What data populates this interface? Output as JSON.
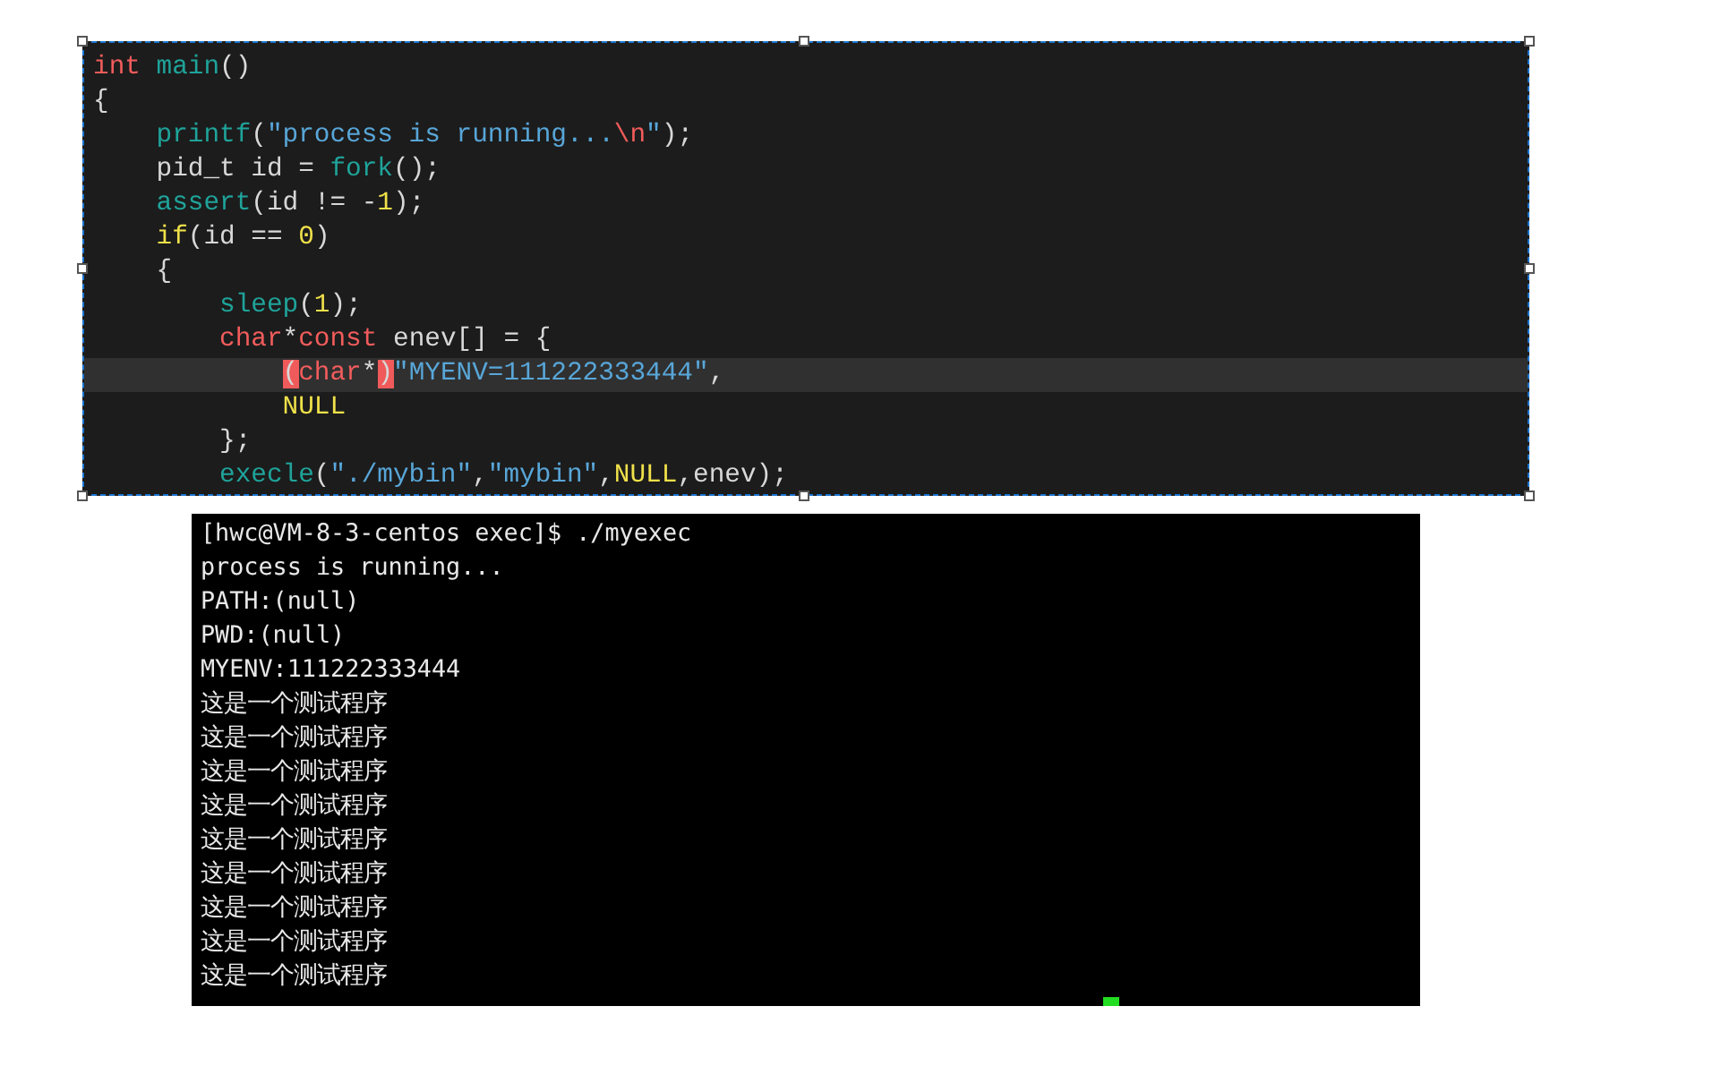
{
  "editor": {
    "lines": [
      {
        "current": false,
        "tokens": [
          {
            "text": "int ",
            "kind": "keyword"
          },
          {
            "text": "main",
            "kind": "function"
          },
          {
            "text": "()",
            "kind": "plain"
          }
        ]
      },
      {
        "current": false,
        "tokens": [
          {
            "text": "{",
            "kind": "plain"
          }
        ]
      },
      {
        "current": false,
        "tokens": [
          {
            "text": "    printf",
            "kind": "function"
          },
          {
            "text": "(",
            "kind": "plain"
          },
          {
            "text": "\"process is running...",
            "kind": "string"
          },
          {
            "text": "\\n",
            "kind": "escape"
          },
          {
            "text": "\"",
            "kind": "string"
          },
          {
            "text": ");",
            "kind": "plain"
          }
        ]
      },
      {
        "current": false,
        "tokens": [
          {
            "text": "    pid_t id = ",
            "kind": "plain"
          },
          {
            "text": "fork",
            "kind": "function"
          },
          {
            "text": "();",
            "kind": "plain"
          }
        ]
      },
      {
        "current": false,
        "tokens": [
          {
            "text": "    assert",
            "kind": "function"
          },
          {
            "text": "(id != -",
            "kind": "plain"
          },
          {
            "text": "1",
            "kind": "number"
          },
          {
            "text": ");",
            "kind": "plain"
          }
        ]
      },
      {
        "current": false,
        "tokens": [
          {
            "text": "    if",
            "kind": "control"
          },
          {
            "text": "(id == ",
            "kind": "plain"
          },
          {
            "text": "0",
            "kind": "number"
          },
          {
            "text": ")",
            "kind": "plain"
          }
        ]
      },
      {
        "current": false,
        "tokens": [
          {
            "text": "    {",
            "kind": "plain"
          }
        ]
      },
      {
        "current": false,
        "tokens": [
          {
            "text": "        sleep",
            "kind": "function"
          },
          {
            "text": "(",
            "kind": "plain"
          },
          {
            "text": "1",
            "kind": "number"
          },
          {
            "text": ");",
            "kind": "plain"
          }
        ]
      },
      {
        "current": false,
        "tokens": [
          {
            "text": "        char",
            "kind": "keyword"
          },
          {
            "text": "*",
            "kind": "plain"
          },
          {
            "text": "const",
            "kind": "keyword"
          },
          {
            "text": " enev[] = {",
            "kind": "plain"
          }
        ]
      },
      {
        "current": true,
        "tokens": [
          {
            "text": "            (",
            "kind": "bracket_match"
          },
          {
            "text": "char",
            "kind": "keyword"
          },
          {
            "text": "*",
            "kind": "plain"
          },
          {
            "text": ")",
            "kind": "bracket_match"
          },
          {
            "text": "\"MYENV=111222333444\"",
            "kind": "string"
          },
          {
            "text": ",",
            "kind": "plain"
          }
        ]
      },
      {
        "current": false,
        "tokens": [
          {
            "text": "            NULL",
            "kind": "control"
          }
        ]
      },
      {
        "current": false,
        "tokens": [
          {
            "text": "        };",
            "kind": "plain"
          }
        ]
      },
      {
        "current": false,
        "tokens": [
          {
            "text": "        execle",
            "kind": "function"
          },
          {
            "text": "(",
            "kind": "plain"
          },
          {
            "text": "\"./mybin\"",
            "kind": "string"
          },
          {
            "text": ",",
            "kind": "plain"
          },
          {
            "text": "\"mybin\"",
            "kind": "string"
          },
          {
            "text": ",",
            "kind": "plain"
          },
          {
            "text": "NULL",
            "kind": "control"
          },
          {
            "text": ",enev);",
            "kind": "plain"
          }
        ]
      }
    ]
  },
  "terminal": {
    "lines": [
      "[hwc@VM-8-3-centos exec]$ ./myexec",
      "process is running...",
      "PATH:(null)",
      "PWD:(null)",
      "MYENV:111222333444",
      "这是一个测试程序",
      "这是一个测试程序",
      "这是一个测试程序",
      "这是一个测试程序",
      "这是一个测试程序",
      "这是一个测试程序",
      "这是一个测试程序",
      "这是一个测试程序",
      "这是一个测试程序"
    ]
  }
}
